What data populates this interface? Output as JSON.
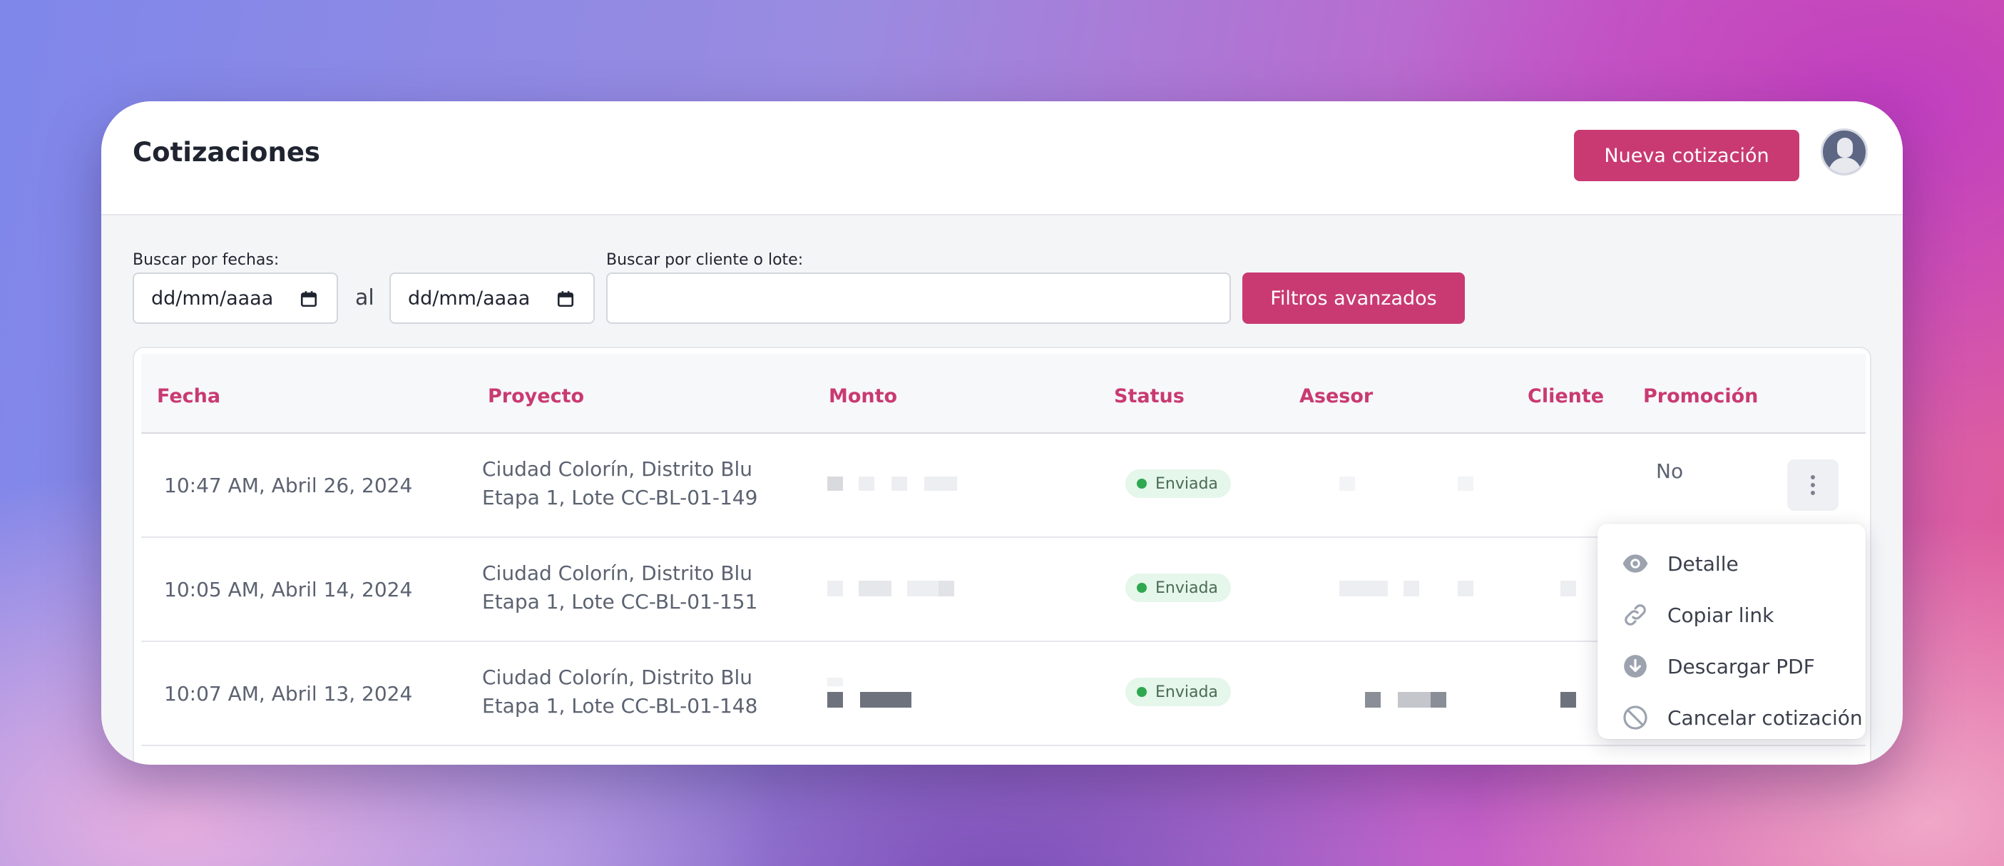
{
  "header": {
    "title": "Cotizaciones",
    "new_button_label": "Nueva cotización"
  },
  "filters": {
    "date_label": "Buscar por fechas:",
    "date_from_placeholder": "dd/mm/aaaa",
    "date_separator": "al",
    "date_to_placeholder": "dd/mm/aaaa",
    "search_label": "Buscar por cliente o lote:",
    "search_value": "",
    "advanced_button_label": "Filtros avanzados"
  },
  "table": {
    "columns": [
      "Fecha",
      "Proyecto",
      "Monto",
      "Status",
      "Asesor",
      "Cliente",
      "Promoción"
    ],
    "rows": [
      {
        "fecha": "10:47 AM, Abril 26, 2024",
        "proyecto_line1": "Ciudad Colorín, Distrito Blu",
        "proyecto_line2": "Etapa 1, Lote CC-BL-01-149",
        "status": "Enviada",
        "promocion": "No"
      },
      {
        "fecha": "10:05 AM, Abril 14, 2024",
        "proyecto_line1": "Ciudad Colorín, Distrito Blu",
        "proyecto_line2": "Etapa 1, Lote CC-BL-01-151",
        "status": "Enviada"
      },
      {
        "fecha": "10:07 AM, Abril 13, 2024",
        "proyecto_line1": "Ciudad Colorín, Distrito Blu",
        "proyecto_line2": "Etapa 1, Lote CC-BL-01-148",
        "status": "Enviada"
      }
    ]
  },
  "row_menu": {
    "items": [
      {
        "label": "Detalle",
        "icon": "eye-icon"
      },
      {
        "label": "Copiar link",
        "icon": "link-icon"
      },
      {
        "label": "Descargar PDF",
        "icon": "download-icon"
      },
      {
        "label": "Cancelar cotización",
        "icon": "cancel-icon"
      }
    ]
  },
  "colors": {
    "accent": "#c93a72",
    "status_green": "#2fa84f"
  }
}
